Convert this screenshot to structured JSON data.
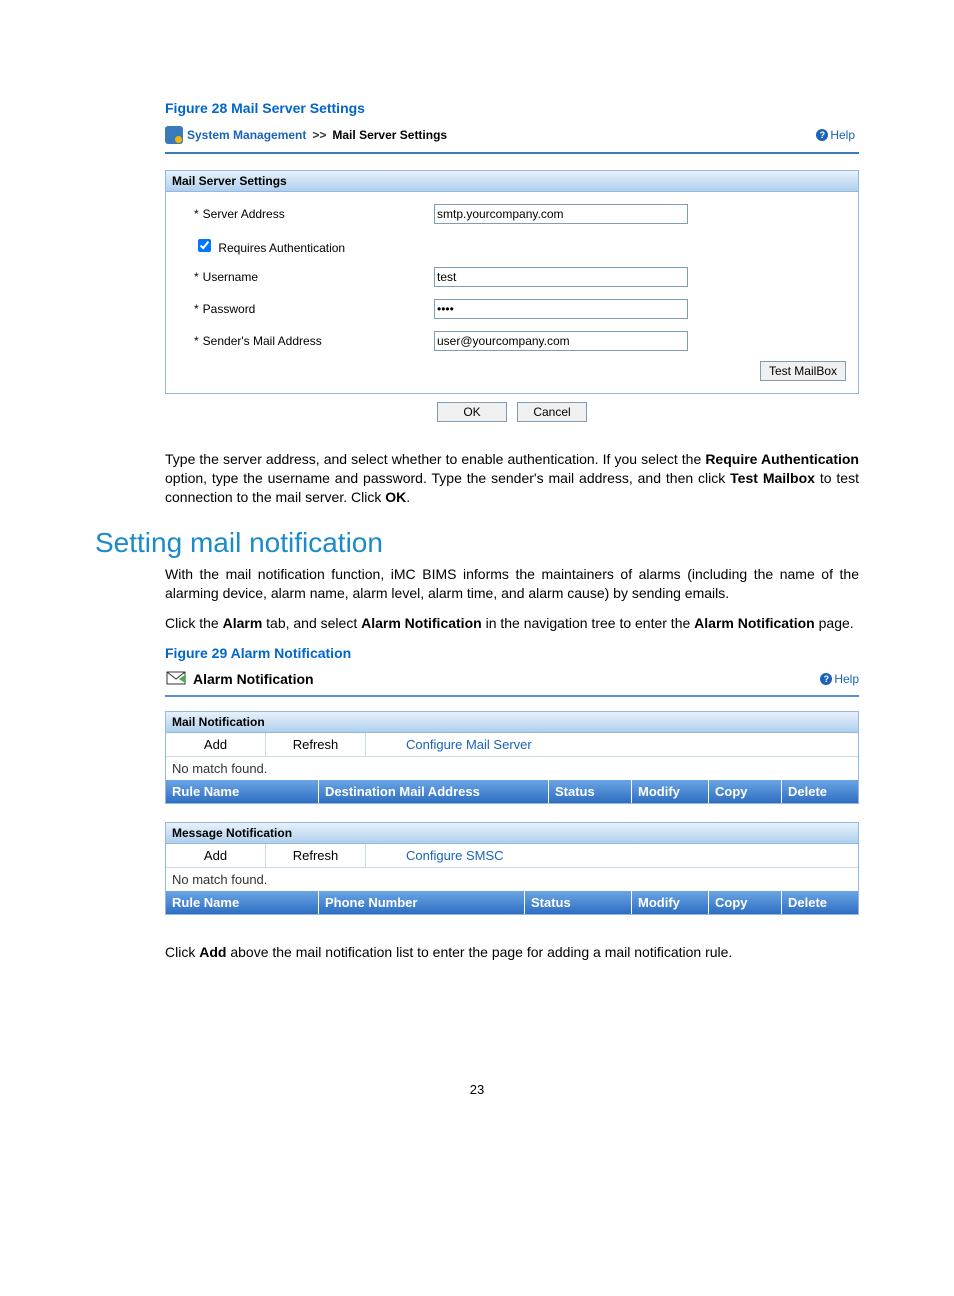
{
  "figure28": {
    "caption": "Figure 28 Mail Server Settings",
    "breadcrumb": {
      "link": "System Management",
      "sep": ">>",
      "current": "Mail Server Settings"
    },
    "help": "Help",
    "panel_title": "Mail Server Settings",
    "rows": {
      "server_address": {
        "label": "Server Address",
        "value": "smtp.yourcompany.com"
      },
      "requires_auth": {
        "label": "Requires Authentication"
      },
      "username": {
        "label": "Username",
        "value": "test"
      },
      "password": {
        "label": "Password",
        "value": "••••"
      },
      "sender": {
        "label": "Sender's Mail Address",
        "value": "user@yourcompany.com"
      }
    },
    "test_btn": "Test MailBox",
    "ok": "OK",
    "cancel": "Cancel"
  },
  "para1_a": "Type the server address, and select whether to enable authentication. If you select the ",
  "para1_b": "Require Authentication",
  "para1_c": " option, type the username and password. Type the sender's mail address, and then click ",
  "para1_d": "Test Mailbox",
  "para1_e": " to test connection to the mail server. Click ",
  "para1_f": "OK",
  "para1_g": ".",
  "heading": "Setting mail notification",
  "para2": "With the mail notification function, iMC BIMS informs the maintainers of alarms (including the name of the alarming device, alarm name, alarm level, alarm time, and alarm cause) by sending emails.",
  "para3_a": "Click the ",
  "para3_b": "Alarm",
  "para3_c": " tab, and select ",
  "para3_d": "Alarm Notification",
  "para3_e": " in the navigation tree to enter the ",
  "para3_f": "Alarm Notification",
  "para3_g": " page.",
  "figure29": {
    "caption": "Figure 29 Alarm Notification",
    "title": "Alarm Notification",
    "help": "Help",
    "mail": {
      "section": "Mail Notification",
      "add": "Add",
      "refresh": "Refresh",
      "config": "Configure Mail Server",
      "nomatch": "No match found.",
      "cols": {
        "rule": "Rule Name",
        "dest": "Destination Mail Address",
        "status": "Status",
        "modify": "Modify",
        "copy": "Copy",
        "delete": "Delete"
      }
    },
    "msg": {
      "section": "Message Notification",
      "add": "Add",
      "refresh": "Refresh",
      "config": "Configure SMSC",
      "nomatch": "No match found.",
      "cols": {
        "rule": "Rule Name",
        "phone": "Phone Number",
        "status": "Status",
        "modify": "Modify",
        "copy": "Copy",
        "delete": "Delete"
      }
    }
  },
  "para4_a": "Click ",
  "para4_b": "Add",
  "para4_c": " above the mail notification list to enter the page for adding a mail notification rule.",
  "page_num": "23"
}
